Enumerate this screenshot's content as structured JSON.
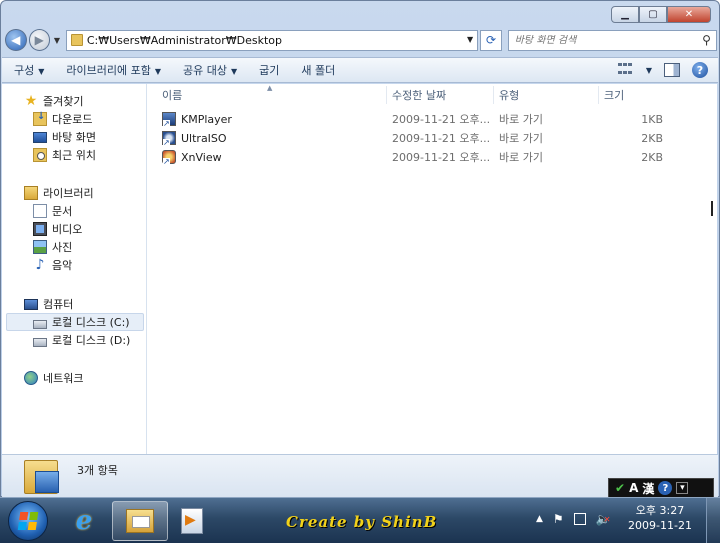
{
  "window": {
    "caption_buttons": [
      "minimize",
      "maximize",
      "close"
    ]
  },
  "address_bar": {
    "path": "C:₩Users₩Administrator₩Desktop",
    "search_placeholder": "바탕 화면 검색"
  },
  "toolbar": {
    "items": [
      {
        "label": "구성",
        "has_dropdown": true
      },
      {
        "label": "라이브러리에 포함",
        "has_dropdown": true
      },
      {
        "label": "공유 대상",
        "has_dropdown": true
      },
      {
        "label": "굽기",
        "has_dropdown": false
      },
      {
        "label": "새 폴더",
        "has_dropdown": false
      }
    ]
  },
  "nav_pane": {
    "favorites": {
      "label": "즐겨찾기",
      "items": [
        "다운로드",
        "바탕 화면",
        "최근 위치"
      ]
    },
    "libraries": {
      "label": "라이브러리",
      "items": [
        "문서",
        "비디오",
        "사진",
        "음악"
      ]
    },
    "computer": {
      "label": "컴퓨터",
      "items": [
        "로컬 디스크 (C:)",
        "로컬 디스크 (D:)"
      ],
      "selected": "로컬 디스크 (C:)"
    },
    "network": {
      "label": "네트워크"
    }
  },
  "file_list": {
    "columns": [
      "이름",
      "수정한 날짜",
      "유형",
      "크기"
    ],
    "rows": [
      {
        "name": "KMPlayer",
        "modified": "2009-11-21 오후...",
        "type": "바로 가기",
        "size": "1KB",
        "icon": "kmplayer-icon"
      },
      {
        "name": "UltraISO",
        "modified": "2009-11-21 오후...",
        "type": "바로 가기",
        "size": "2KB",
        "icon": "ultraiso-icon"
      },
      {
        "name": "XnView",
        "modified": "2009-11-21 오후...",
        "type": "바로 가기",
        "size": "2KB",
        "icon": "xnview-icon"
      }
    ]
  },
  "details_pane": {
    "item_count": "3개 항목"
  },
  "language_bar": {
    "mode_label": "A",
    "hanja_label": "漢",
    "help": "?"
  },
  "taskbar": {
    "credit": "Create by ShinB",
    "clock_time": "오후 3:27",
    "clock_date": "2009-11-21"
  }
}
